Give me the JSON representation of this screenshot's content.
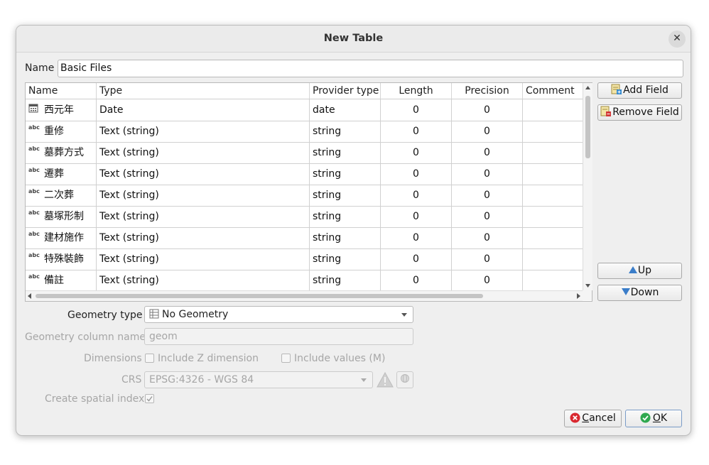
{
  "dialog": {
    "title": "New Table",
    "close_glyph": "✕"
  },
  "name_field": {
    "label": "Name",
    "value": "Basic Files"
  },
  "table": {
    "columns": [
      "Name",
      "Type",
      "Provider type",
      "Length",
      "Precision",
      "Comment"
    ],
    "rows": [
      {
        "icon": "calendar-icon",
        "name": "西元年",
        "type": "Date",
        "provider": "date",
        "length": "0",
        "precision": "0",
        "comment": ""
      },
      {
        "icon": "text-field-icon",
        "name": "重修",
        "type": "Text (string)",
        "provider": "string",
        "length": "0",
        "precision": "0",
        "comment": ""
      },
      {
        "icon": "text-field-icon",
        "name": "墓葬方式",
        "type": "Text (string)",
        "provider": "string",
        "length": "0",
        "precision": "0",
        "comment": ""
      },
      {
        "icon": "text-field-icon",
        "name": "遷葬",
        "type": "Text (string)",
        "provider": "string",
        "length": "0",
        "precision": "0",
        "comment": ""
      },
      {
        "icon": "text-field-icon",
        "name": "二次葬",
        "type": "Text (string)",
        "provider": "string",
        "length": "0",
        "precision": "0",
        "comment": ""
      },
      {
        "icon": "text-field-icon",
        "name": "墓塚形制",
        "type": "Text (string)",
        "provider": "string",
        "length": "0",
        "precision": "0",
        "comment": ""
      },
      {
        "icon": "text-field-icon",
        "name": "建材施作",
        "type": "Text (string)",
        "provider": "string",
        "length": "0",
        "precision": "0",
        "comment": ""
      },
      {
        "icon": "text-field-icon",
        "name": "特殊裝飾",
        "type": "Text (string)",
        "provider": "string",
        "length": "0",
        "precision": "0",
        "comment": ""
      },
      {
        "icon": "text-field-icon",
        "name": "備註",
        "type": "Text (string)",
        "provider": "string",
        "length": "0",
        "precision": "0",
        "comment": ""
      }
    ]
  },
  "side_buttons": {
    "add_field": "Add Field",
    "remove_field": "Remove Field",
    "up": "Up",
    "down": "Down"
  },
  "geometry": {
    "type_label": "Geometry type",
    "type_value": "No Geometry",
    "column_label": "Geometry column name",
    "column_value": "geom",
    "dimensions_label": "Dimensions",
    "include_z": "Include Z dimension",
    "include_m": "Include values (M)",
    "crs_label": "CRS",
    "crs_value": "EPSG:4326 - WGS 84",
    "spatial_index_label": "Create spatial index",
    "spatial_index_checked": true
  },
  "footer": {
    "cancel_first": "C",
    "cancel_rest": "ancel",
    "ok_first": "O",
    "ok_rest": "K"
  },
  "colors": {
    "cancel_icon": "#d9282f",
    "ok_icon": "#2fa84f",
    "warning_icon": "#bdbdbd"
  }
}
